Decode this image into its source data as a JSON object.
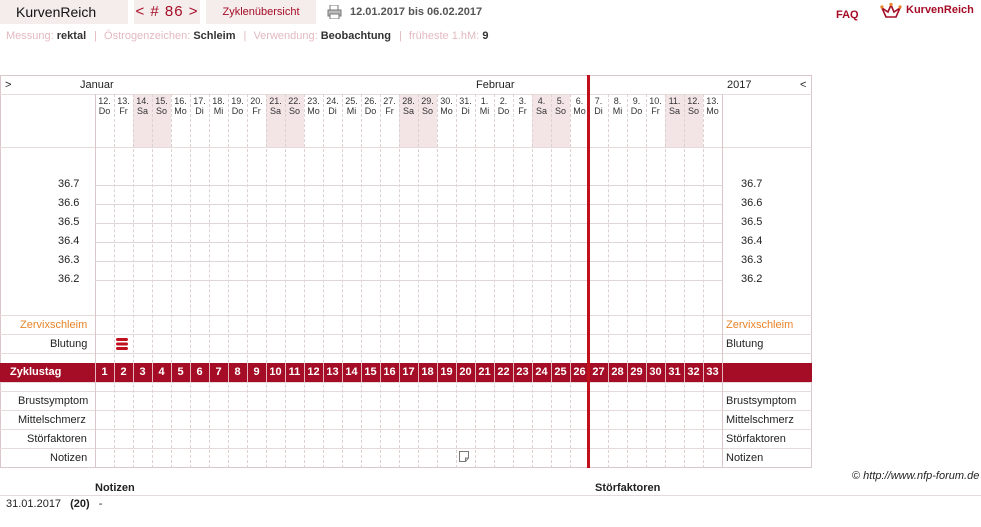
{
  "app": {
    "brand": "KurvenReich",
    "nav_label": "< # 86 >",
    "overview_label": "Zyklenübersicht",
    "date_range": "12.01.2017 bis 06.02.2017",
    "faq": "FAQ",
    "logo_text": "KurvenReich"
  },
  "info": {
    "messung_label": "Messung:",
    "messung_value": "rektal",
    "oestrogen_label": "Östrogenzeichen:",
    "oestrogen_value": "Schleim",
    "verwendung_label": "Verwendung:",
    "verwendung_value": "Beobachtung",
    "hm_label": "früheste 1.hM:",
    "hm_value": "9"
  },
  "chart_header": {
    "left_arrow": ">",
    "right_arrow": "<",
    "month_left": "Januar",
    "month_mid": "Februar",
    "year": "2017"
  },
  "chart_data": {
    "type": "line",
    "days": [
      {
        "date": "12.",
        "wd": "Do",
        "weekend": false
      },
      {
        "date": "13.",
        "wd": "Fr",
        "weekend": false
      },
      {
        "date": "14.",
        "wd": "Sa",
        "weekend": true
      },
      {
        "date": "15.",
        "wd": "So",
        "weekend": true
      },
      {
        "date": "16.",
        "wd": "Mo",
        "weekend": false
      },
      {
        "date": "17.",
        "wd": "Di",
        "weekend": false
      },
      {
        "date": "18.",
        "wd": "Mi",
        "weekend": false
      },
      {
        "date": "19.",
        "wd": "Do",
        "weekend": false
      },
      {
        "date": "20.",
        "wd": "Fr",
        "weekend": false
      },
      {
        "date": "21.",
        "wd": "Sa",
        "weekend": true
      },
      {
        "date": "22.",
        "wd": "So",
        "weekend": true
      },
      {
        "date": "23.",
        "wd": "Mo",
        "weekend": false
      },
      {
        "date": "24.",
        "wd": "Di",
        "weekend": false
      },
      {
        "date": "25.",
        "wd": "Mi",
        "weekend": false
      },
      {
        "date": "26.",
        "wd": "Do",
        "weekend": false
      },
      {
        "date": "27.",
        "wd": "Fr",
        "weekend": false
      },
      {
        "date": "28.",
        "wd": "Sa",
        "weekend": true
      },
      {
        "date": "29.",
        "wd": "So",
        "weekend": true
      },
      {
        "date": "30.",
        "wd": "Mo",
        "weekend": false
      },
      {
        "date": "31.",
        "wd": "Di",
        "weekend": false
      },
      {
        "date": "1.",
        "wd": "Mi",
        "weekend": false
      },
      {
        "date": "2.",
        "wd": "Do",
        "weekend": false
      },
      {
        "date": "3.",
        "wd": "Fr",
        "weekend": false
      },
      {
        "date": "4.",
        "wd": "Sa",
        "weekend": true
      },
      {
        "date": "5.",
        "wd": "So",
        "weekend": true
      },
      {
        "date": "6.",
        "wd": "Mo",
        "weekend": false
      },
      {
        "date": "7.",
        "wd": "Di",
        "weekend": false
      },
      {
        "date": "8.",
        "wd": "Mi",
        "weekend": false
      },
      {
        "date": "9.",
        "wd": "Do",
        "weekend": false
      },
      {
        "date": "10.",
        "wd": "Fr",
        "weekend": false
      },
      {
        "date": "11.",
        "wd": "Sa",
        "weekend": true
      },
      {
        "date": "12.",
        "wd": "So",
        "weekend": true
      },
      {
        "date": "13.",
        "wd": "Mo",
        "weekend": false
      }
    ],
    "y_ticks": [
      "36.7",
      "36.6",
      "36.5",
      "36.4",
      "36.3",
      "36.2"
    ],
    "ylim": [
      36.2,
      36.7
    ],
    "cycle_days": [
      1,
      2,
      3,
      4,
      5,
      6,
      7,
      8,
      9,
      10,
      11,
      12,
      13,
      14,
      15,
      16,
      17,
      18,
      19,
      20,
      21,
      22,
      23,
      24,
      25,
      26,
      27,
      28,
      29,
      30,
      31,
      32,
      33
    ],
    "temperatures": [],
    "bleeding_cycle_day": 2,
    "note_cycle_day": 20,
    "current_cycle_day_boundary": 26
  },
  "rows": {
    "zervix": "Zervixschleim",
    "blutung": "Blutung",
    "zyklustag": "Zyklustag",
    "brust": "Brustsymptom",
    "mittel": "Mittelschmerz",
    "stoer": "Störfaktoren",
    "notizen": "Notizen"
  },
  "colors": {
    "accent": "#a50d26",
    "zervix": "#e8842a",
    "weekend": "#f3e4e6"
  },
  "copyright": "http://www.nfp-forum.de",
  "bottom": {
    "notizen_header": "Notizen",
    "stoer_header": "Störfaktoren",
    "entry_date": "31.01.2017",
    "entry_day": "(20)",
    "entry_text": "-"
  }
}
